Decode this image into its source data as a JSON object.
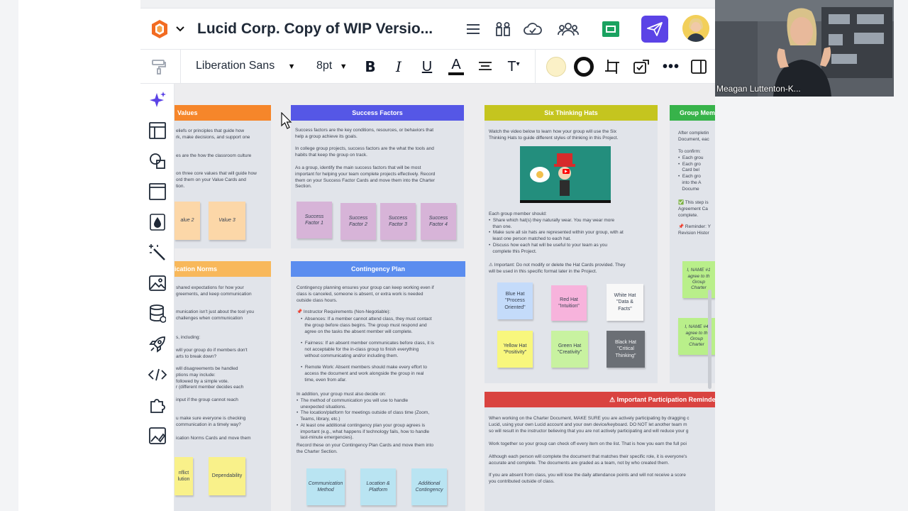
{
  "app": {
    "doc_title": "Lucid Corp. Copy of WIP Versio...",
    "colors": {
      "accent": "#5b43e6",
      "orange": "#f6862a",
      "indigo": "#5557e6",
      "olive": "#c5c51f",
      "green": "#37b34a",
      "blue": "#5b8def",
      "red": "#d94340"
    }
  },
  "header_icons": [
    "menu-icon",
    "shapes-library-icon",
    "cloud-sync-icon",
    "collaborators-icon",
    "slides-icon",
    "share-icon",
    "avatar"
  ],
  "toolbar": {
    "font_name": "Liberation Sans",
    "font_size": "8pt",
    "format_icons": [
      "format-painter-icon",
      "bold-icon",
      "italic-icon",
      "underline-icon",
      "text-color-icon",
      "align-icon",
      "text-size-icon",
      "fill-color-icon",
      "line-color-icon",
      "frame-icon",
      "review-icon",
      "more-icon",
      "panel-toggle-icon"
    ]
  },
  "rail_icons": [
    "ai-sparkle-icon",
    "templates-icon",
    "shapes-icon",
    "frame-icon",
    "fill-drop-icon",
    "magic-wand-icon",
    "image-icon",
    "data-icon",
    "rocket-icon",
    "code-icon",
    "integrations-icon",
    "image-edit-icon"
  ],
  "canvas": {
    "values": {
      "title": "Values",
      "p1": "eliefs or principles that guide how\nrk, make decisions, and support one",
      "p2": "es are the how the classroom culture",
      "p3": "on three core values that will guide how\nord them on your Value Cards and\ntion.",
      "stickies": [
        "alue 2",
        "Value 3"
      ]
    },
    "success": {
      "title": "Success Factors",
      "p1": "Success factors are the key conditions, resources, or behaviors that\nhelp a group achieve its goals.",
      "p2": "In college group projects, success factors are the what the tools and\nhabits that keep the group on track.",
      "p3": "As a group, identify the main success factors that will be most\nimportant for helping your team complete projects effectively. Record\nthem on your Success Factor Cards and move them into the Charter\nSection.",
      "stickies": [
        "Success\nFactor 1",
        "Success\nFactor 2",
        "Success\nFactor 3",
        "Success\nFactor 4"
      ]
    },
    "hats": {
      "title": "Six Thinking Hats",
      "p1": "Watch the video below to learn how your group will use the Six\nThinking Hats to guide different styles of thinking in this Project.",
      "p2": "Each group member should:\n•  Share which hat(s) they naturally wear. You may wear more\n   than one.\n•  Make sure all six hats are represented within your group, with at\n   least one person matched to each hat.\n•  Discuss how each hat will be useful to your team as you\n   complete this Project.",
      "p3": "⚠ Important: Do not modify or delete the Hat Cards provided. They\nwill be used in this specific format later in the Project.",
      "stickies": [
        "Blue Hat\n\"Process\nOriented\"",
        "Red Hat\n\"Intuition\"",
        "White Hat\n\"Data &\nFacts\"",
        "Yellow Hat\n\"Positivity\"",
        "Green Hat\n\"Creativity\"",
        "Black Hat\n\"Critical\nThinking\""
      ]
    },
    "group": {
      "title": "Group Mem",
      "p1": "After completin\nDocument, eac",
      "p2": "To confirm:\n•  Each grou\n•  Each gro\n   Card bel\n•  Each gro\n   into the A\n   Docume",
      "p3": "✅ This step is\nAgreement Ca\ncomplete.",
      "p4": "📌 Reminder: Y\nRevision Histor",
      "stickies": [
        "I, NAME #1\nagree to th\nGroup\nCharter",
        "I, NAME #4\nagree to th\nGroup\nCharter"
      ]
    },
    "norms": {
      "title": "ication Norms",
      "p1": "shared expectations for how your\ngreements, and keep communication",
      "p2": "munication isn't just about the tool you\nchallenges when communication",
      "p3": "s, including:",
      "p4": "will your group do if members don't\narts to break down?",
      "p5": "will disagreements be handled\nptions may include:\nfollowed by a simple vote.\nr (different member decides each",
      "p6": "input if the group cannot reach",
      "p7": "u make sure everyone is checking\ncommunication in a timely way?",
      "p8": "ication Norms Cards and move them",
      "stickies": [
        "nflict\nlution",
        "Dependability"
      ]
    },
    "contingency": {
      "title": "Contingency Plan",
      "p1": "Contingency planning ensures your group can keep working even if\nclass is canceled, someone is absent, or extra work is needed\noutside class hours.",
      "p2": "📌 Instructor Requirements (Non-Negotiable):",
      "p3": "•  Absences: If a member cannot attend class, they must contact\n   the group before class begins. The group must respond and\n   agree on the tasks the absent member will complete.",
      "p4": "•  Fairness: If an absent member communicates before class, it is\n   not acceptable for the in-class group to finish everything\n   without communicating and/or including them.",
      "p5": "•  Remote Work: Absent members should make every effort to\n   access the document and work alongside the group in real\n   time, even from afar.",
      "p6": "In addition, your group must also decide on:\n•  The method of communication you will use to handle\n   unexpected situations.\n•  The location/platform for meetings outside of class time (Zoom,\n   Teams, library, etc.)\n•  At least one additional contingency plan your group agrees is\n   important (e.g., what happens if technology fails, how to handle\n   last-minute emergencies).",
      "p7": "Record these on your Contingency Plan Cards and move them into\nthe Charter Section.",
      "stickies": [
        "Communication\nMethod",
        "Location &\nPlatform",
        "Additional\nContingency"
      ]
    },
    "reminder": {
      "title": "⚠ Important Participation Reminder ⚠",
      "p1": "When working on the Charter Document, MAKE SURE you are actively participating by dragging c\nLucid, using your own Lucid account and your own device/keyboard. DO NOT let another team m\nso will result in the instructor believing that you are not actively participating and will reduce your g",
      "p2": "Work together so your group can check off every item on the list. That is how you earn the full poi",
      "p3": "Although each person will complete the document that matches their specific role, it is everyone's\naccurate and complete. The documents are graded as a team, not by who created them.",
      "p4": "If you are absent from class, you will lose the daily attendance points and will not receive a score\nyou contributed outside of class."
    }
  },
  "video": {
    "participant_name": "Meagan Luttenton-K..."
  }
}
